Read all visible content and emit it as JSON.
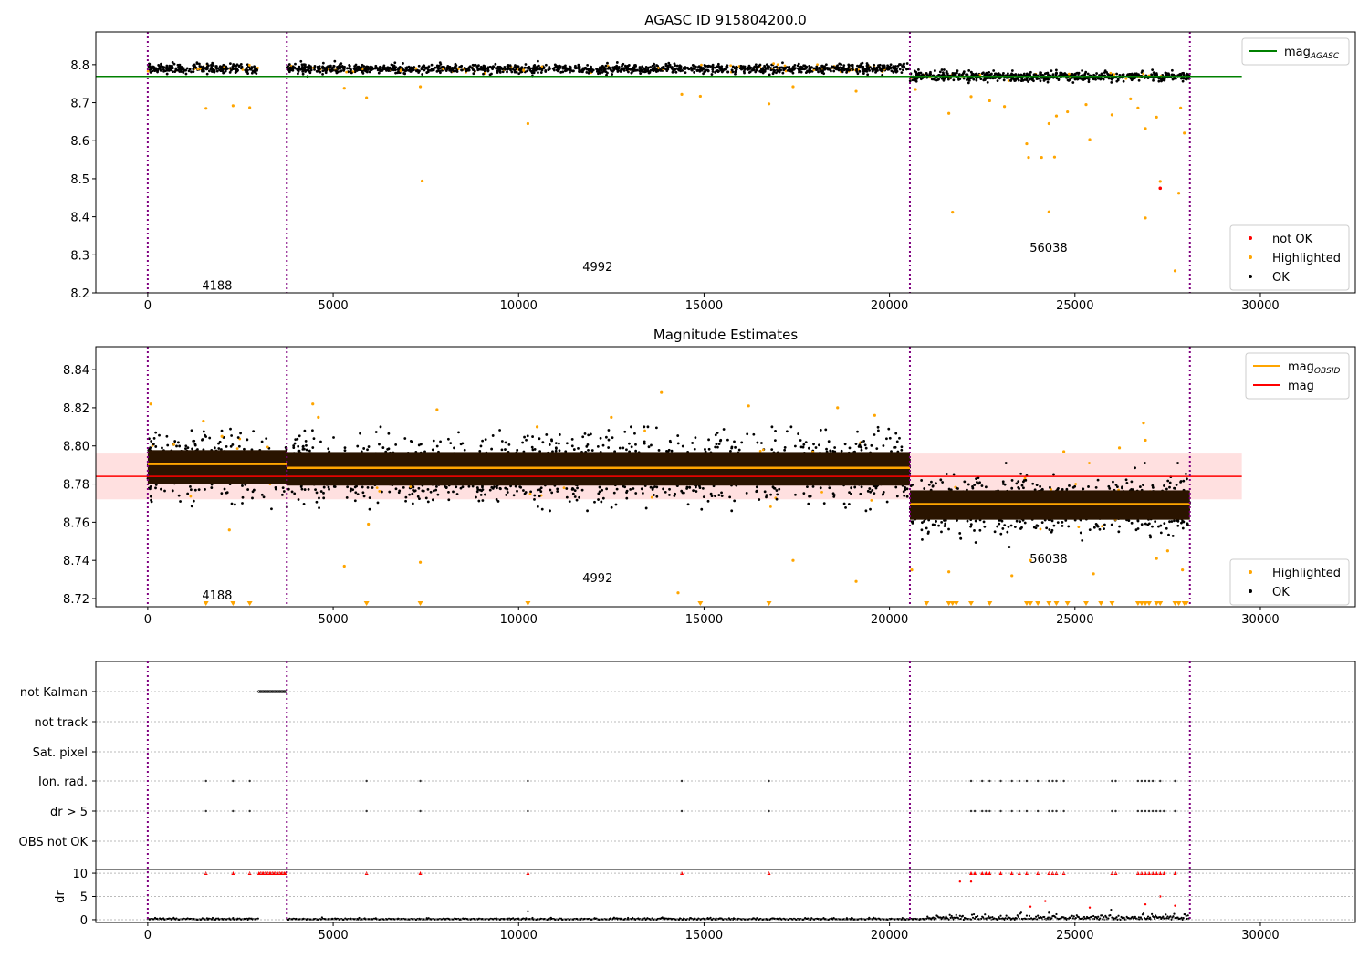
{
  "chart_data": [
    {
      "type": "scatter",
      "title": "AGASC ID 915804200.0",
      "xlim": [
        -1400,
        32560
      ],
      "ylim": [
        8.2,
        8.886
      ],
      "xticks": [
        0,
        5000,
        10000,
        15000,
        20000,
        25000,
        30000
      ],
      "yticks": [
        8.2,
        8.3,
        8.4,
        8.5,
        8.6,
        8.7,
        8.8
      ],
      "ytick_labels": [
        "8.2",
        "8.3",
        "8.4",
        "8.5",
        "8.6",
        "8.7",
        "8.8"
      ],
      "hlines": [
        {
          "name": "mag_AGASC",
          "y": 8.769,
          "x": [
            -1400,
            29500
          ],
          "color": "#008000"
        }
      ],
      "segments": [
        {
          "obsid": "4188",
          "x": [
            0,
            3000
          ],
          "center": 8.79,
          "spread": 0.01,
          "label_x": 1870,
          "label_y": 8.22
        },
        {
          "obsid": "4992",
          "x": [
            3750,
            20550
          ],
          "center": 8.789,
          "spread": 0.01,
          "label_x": 12130,
          "label_y": 8.27
        },
        {
          "obsid": "56038",
          "x": [
            20550,
            28100
          ],
          "center": 8.769,
          "spread": 0.01,
          "label_x": 24290,
          "label_y": 8.32
        }
      ],
      "highlighted_outliers": [
        [
          1570,
          8.685
        ],
        [
          2300,
          8.692
        ],
        [
          2750,
          8.687
        ],
        [
          5300,
          8.738
        ],
        [
          5900,
          8.713
        ],
        [
          7350,
          8.742
        ],
        [
          7400,
          8.494
        ],
        [
          10250,
          8.645
        ],
        [
          14400,
          8.722
        ],
        [
          14900,
          8.717
        ],
        [
          16750,
          8.697
        ],
        [
          17400,
          8.742
        ],
        [
          19100,
          8.73
        ],
        [
          20700,
          8.735
        ],
        [
          21600,
          8.672
        ],
        [
          21700,
          8.412
        ],
        [
          22200,
          8.716
        ],
        [
          22700,
          8.705
        ],
        [
          23100,
          8.69
        ],
        [
          23700,
          8.592
        ],
        [
          23750,
          8.556
        ],
        [
          24100,
          8.556
        ],
        [
          24300,
          8.645
        ],
        [
          24300,
          8.413
        ],
        [
          24450,
          8.557
        ],
        [
          24500,
          8.665
        ],
        [
          24800,
          8.676
        ],
        [
          25300,
          8.695
        ],
        [
          25400,
          8.603
        ],
        [
          26000,
          8.668
        ],
        [
          26500,
          8.71
        ],
        [
          26700,
          8.686
        ],
        [
          26900,
          8.632
        ],
        [
          26900,
          8.397
        ],
        [
          27200,
          8.662
        ],
        [
          27300,
          8.493
        ],
        [
          27700,
          8.258
        ],
        [
          27800,
          8.462
        ],
        [
          27950,
          8.62
        ],
        [
          27850,
          8.686
        ]
      ],
      "not_ok_points": [
        [
          27300,
          8.475
        ]
      ],
      "legend": {
        "position": "top-right",
        "entries": [
          "mag_AGASC"
        ]
      },
      "legend2": {
        "position": "lower-right",
        "entries": [
          "not OK",
          "Highlighted",
          "OK"
        ]
      }
    },
    {
      "type": "scatter",
      "title": "Magnitude Estimates",
      "xlim": [
        -1400,
        32560
      ],
      "ylim": [
        8.7157,
        8.852
      ],
      "xticks": [
        0,
        5000,
        10000,
        15000,
        20000,
        25000,
        30000
      ],
      "yticks": [
        8.72,
        8.74,
        8.76,
        8.78,
        8.8,
        8.82,
        8.84
      ],
      "ytick_labels": [
        "8.72",
        "8.74",
        "8.76",
        "8.78",
        "8.80",
        "8.82",
        "8.84"
      ],
      "mag": 8.784,
      "mag_band": [
        8.772,
        8.796
      ],
      "segments": [
        {
          "obsid": "4188",
          "x": [
            0,
            3750
          ],
          "mag_obsid": 8.7905,
          "center": 8.789,
          "spread": 0.008,
          "label_x": 1870,
          "label_y": 8.722
        },
        {
          "obsid": "4992",
          "x": [
            3750,
            20550
          ],
          "mag_obsid": 8.7885,
          "center": 8.788,
          "spread": 0.008,
          "label_x": 12130,
          "label_y": 8.731
        },
        {
          "obsid": "56038",
          "x": [
            20550,
            28100
          ],
          "mag_obsid": 8.7695,
          "center": 8.769,
          "spread": 0.007,
          "label_x": 24290,
          "label_y": 8.741
        }
      ],
      "highlighted_outliers": [
        [
          80,
          8.822
        ],
        [
          1500,
          8.813
        ],
        [
          2000,
          8.805
        ],
        [
          2200,
          8.756
        ],
        [
          4450,
          8.822
        ],
        [
          4600,
          8.815
        ],
        [
          5300,
          8.737
        ],
        [
          5950,
          8.759
        ],
        [
          7350,
          8.739
        ],
        [
          7800,
          8.819
        ],
        [
          10500,
          8.81
        ],
        [
          12500,
          8.815
        ],
        [
          13850,
          8.828
        ],
        [
          14300,
          8.723
        ],
        [
          16200,
          8.821
        ],
        [
          17400,
          8.74
        ],
        [
          18600,
          8.82
        ],
        [
          19100,
          8.729
        ],
        [
          19600,
          8.816
        ],
        [
          20600,
          8.735
        ],
        [
          21600,
          8.734
        ],
        [
          23300,
          8.732
        ],
        [
          23800,
          8.74
        ],
        [
          24700,
          8.797
        ],
        [
          25500,
          8.733
        ],
        [
          26200,
          8.799
        ],
        [
          26850,
          8.812
        ],
        [
          26900,
          8.803
        ],
        [
          27200,
          8.741
        ],
        [
          27500,
          8.745
        ],
        [
          27900,
          8.735
        ]
      ],
      "out_of_range_below_x": [
        1570,
        2300,
        2750,
        5900,
        7350,
        10250,
        14900,
        16750,
        21000,
        21600,
        21700,
        21800,
        22200,
        22700,
        23700,
        23800,
        24000,
        24300,
        24500,
        24800,
        25300,
        25700,
        26000,
        26700,
        26800,
        26900,
        27000,
        27200,
        27300,
        27700,
        27800,
        27950,
        28000
      ],
      "legend": {
        "position": "top-right",
        "entries": [
          "mag_OBSID",
          "mag"
        ]
      },
      "legend2": {
        "position": "lower-right",
        "entries": [
          "Highlighted",
          "OK"
        ]
      }
    },
    {
      "type": "scatter",
      "title": "",
      "xlim": [
        -1400,
        32560
      ],
      "xticks": [
        0,
        5000,
        10000,
        15000,
        20000,
        25000,
        30000
      ],
      "flag_categories": [
        "not Kalman",
        "not track",
        "Sat. pixel",
        "Ion. rad.",
        "dr > 5",
        "OBS not OK"
      ],
      "not_kalman_x": [
        3000,
        3750
      ],
      "ion_rad_x": [
        1570,
        2300,
        2750,
        5900,
        7350,
        10250,
        14400,
        16750,
        22200,
        22500,
        22700,
        23000,
        23300,
        23500,
        23700,
        24000,
        24300,
        24400,
        24500,
        24700,
        26000,
        26100,
        26700,
        26800,
        26900,
        27000,
        27100,
        27300,
        27700
      ],
      "dr_gt5_x": [
        1570,
        2300,
        2750,
        5900,
        7350,
        10250,
        14400,
        16750,
        22200,
        22300,
        22500,
        22600,
        22700,
        23000,
        23300,
        23500,
        23700,
        24000,
        24300,
        24400,
        24500,
        24700,
        26000,
        26100,
        26700,
        26800,
        26900,
        27000,
        27100,
        27200,
        27300,
        27400,
        27700
      ],
      "dr_ylabel": "dr",
      "dr_yticks": [
        0,
        5,
        10
      ],
      "dr_ylim": [
        -0.6,
        10.8
      ]
    }
  ],
  "common": {
    "vlines_x": [
      0,
      3750,
      20550,
      28100
    ],
    "colors": {
      "ok": "#000000",
      "highlighted": "#ffa500",
      "not_ok": "#ff0000",
      "mag_agasc": "#008000",
      "mag_obsid": "#ffa500",
      "mag": "#ff0000",
      "vline": "#800080"
    }
  },
  "labels": {
    "mag_agasc_main": "mag",
    "mag_agasc_sub": "AGASC",
    "mag_obsid_main": "mag",
    "mag_obsid_sub": "OBSID",
    "mag": "mag",
    "not_ok": "not OK",
    "highlighted": "Highlighted",
    "ok": "OK"
  }
}
